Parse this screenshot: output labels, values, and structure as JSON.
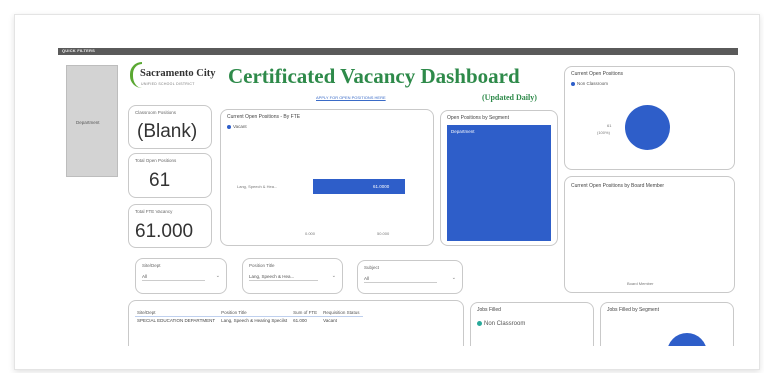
{
  "quick_filters": "QUICK FILTERS",
  "side_panel": {
    "department_label": "Department"
  },
  "logo": {
    "name": "Sacramento City",
    "subtitle": "UNIFIED SCHOOL DISTRICT"
  },
  "header": {
    "title": "Certificated Vacancy Dashboard",
    "apply_link": "APPLY FOR OPEN POSITIONS HERE",
    "updated": "(Updated Daily)"
  },
  "kpis": {
    "classroom_positions": {
      "label": "Classroom Positions",
      "value": "(Blank)"
    },
    "total_open_positions": {
      "label": "Total Open Positions",
      "value": "61"
    },
    "total_fte_vacancy": {
      "label": "Total FTE Vacancy",
      "value": "61.000"
    }
  },
  "fte_chart": {
    "title": "Current Open Positions - By FTE",
    "legend": "Vacant",
    "bar_value_label": "61.0000",
    "x_ticks": [
      "0.000",
      "50.000"
    ],
    "chart_data": {
      "type": "bar",
      "categories": [
        "Lang, Speech & Hea..."
      ],
      "series": [
        {
          "name": "Vacant",
          "values": [
            61
          ]
        }
      ]
    }
  },
  "segment_chart": {
    "title": "Open Positions by Segment",
    "tile_label": "Department"
  },
  "pie_chart": {
    "title": "Current Open Positions",
    "legend": "Non Classroom",
    "slice_label": "61",
    "slice_pct": "(100%)",
    "chart_data": {
      "type": "pie",
      "labels": [
        "Non Classroom"
      ],
      "values": [
        61
      ]
    }
  },
  "board_chart": {
    "title": "Current Open Positions by Board Member",
    "axis_label": "Board Member"
  },
  "slicers": [
    {
      "label": "Site/Dept",
      "value": "All"
    },
    {
      "label": "Position Title",
      "value": "Lang, Speech & Hea..."
    },
    {
      "label": "Subject",
      "value": "All"
    }
  ],
  "table": {
    "headers": [
      "Site/Dept",
      "Position Title",
      "Sum of FTE",
      "Requisition Status"
    ],
    "rows": [
      [
        "SPECIAL EDUCATION DEPARTMENT",
        "Lang, Speech & Hearing Specilst",
        "61.000",
        "Vacant"
      ]
    ]
  },
  "jobs_filled": {
    "title": "Jobs Filled",
    "legend": "Non Classroom"
  },
  "jobs_filled_segment": {
    "title": "Jobs Filled by Segment"
  },
  "colors": {
    "title_green": "#2e8a4a",
    "bar_blue": "#2e5ec9",
    "teal": "#28a99a"
  }
}
